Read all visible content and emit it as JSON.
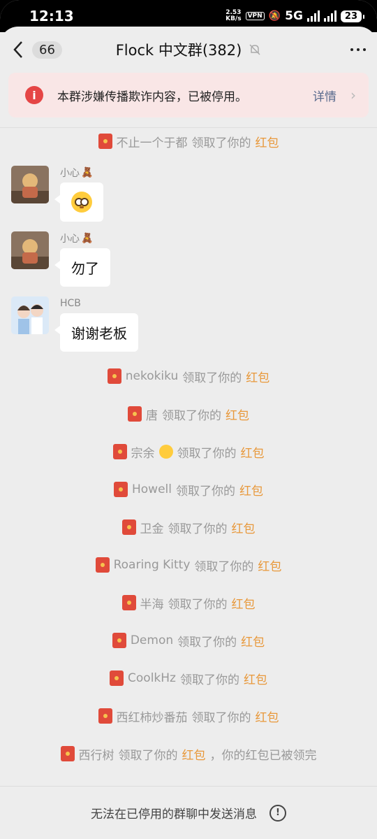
{
  "status_bar": {
    "time": "12:13",
    "speed_value": "2.53",
    "speed_unit": "KB/s",
    "vpn": "VPN",
    "network": "5G",
    "battery": "23"
  },
  "header": {
    "unread_count": "66",
    "title": "Flock 中文群(382)"
  },
  "notice": {
    "text": "本群涉嫌传播欺诈内容，已被停用。",
    "detail": "详情"
  },
  "messages": {
    "sys_top": {
      "name": "不止一个于都",
      "action": "领取了你的",
      "link": "红包"
    },
    "m1": {
      "sender": "小心",
      "bear": "🧸"
    },
    "m2": {
      "sender": "小心",
      "bear": "🧸",
      "text": "勿了"
    },
    "m3": {
      "sender": "HCB",
      "text": "谢谢老板"
    },
    "sys1": {
      "name": "nekokiku",
      "action": "领取了你的",
      "link": "红包"
    },
    "sys2": {
      "name": "唐",
      "action": "领取了你的",
      "link": "红包"
    },
    "sys3": {
      "name": "宗余",
      "action": "领取了你的",
      "link": "红包"
    },
    "sys4": {
      "name": "Howell",
      "action": "领取了你的",
      "link": "红包"
    },
    "sys5": {
      "name": "卫金",
      "action": "领取了你的",
      "link": "红包"
    },
    "sys6": {
      "name": "Roaring Kitty",
      "action": "领取了你的",
      "link": "红包"
    },
    "sys7": {
      "name": "半海",
      "action": "领取了你的",
      "link": "红包"
    },
    "sys8": {
      "name": "Demon",
      "action": "领取了你的",
      "link": "红包"
    },
    "sys9": {
      "name": "CoolkHz",
      "action": "领取了你的",
      "link": "红包"
    },
    "sys10": {
      "name": "西红柿炒番茄",
      "action": "领取了你的",
      "link": "红包"
    },
    "sys11": {
      "name": "西行树",
      "action": "领取了你的",
      "link": "红包",
      "suffix": "，你的红包已被领完"
    }
  },
  "footer": {
    "text": "无法在已停用的群聊中发送消息"
  },
  "colors": {
    "accent_red": "#e04a3a",
    "link_orange": "#e8983a",
    "notice_bg": "#f9e6e6"
  }
}
